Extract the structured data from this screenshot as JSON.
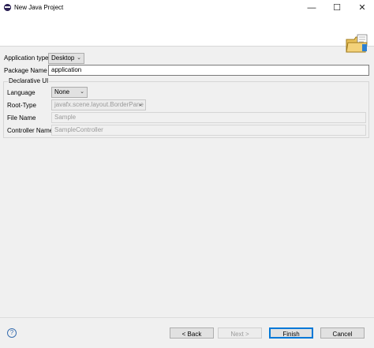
{
  "window": {
    "title": "New Java Project",
    "minimize": "—",
    "maximize": "☐",
    "close": "✕"
  },
  "form": {
    "application_type": {
      "label": "Application type",
      "value": "Desktop"
    },
    "package_name": {
      "label": "Package Name",
      "value": "application"
    },
    "declarative_ui": {
      "title": "Declarative UI",
      "language": {
        "label": "Language",
        "value": "None"
      },
      "root_type": {
        "label": "Root-Type",
        "value": "javafx.scene.layout.BorderPane"
      },
      "file_name": {
        "label": "File Name",
        "placeholder": "Sample"
      },
      "controller_name": {
        "label": "Controller Name",
        "placeholder": "SampleController"
      }
    }
  },
  "footer": {
    "help": "?",
    "back": "< Back",
    "next": "Next >",
    "finish": "Finish",
    "cancel": "Cancel"
  },
  "icons": {
    "app": "eclipse-icon",
    "wizard": "folder-icon",
    "dropdown": "chevron-down-icon"
  },
  "colors": {
    "accent": "#0078d7",
    "panel": "#f0f0f0",
    "header": "#ffffff"
  }
}
